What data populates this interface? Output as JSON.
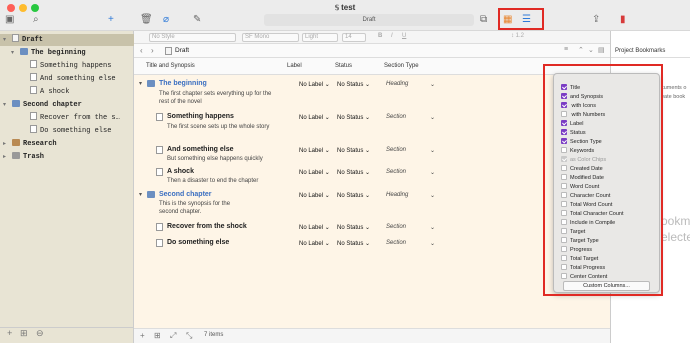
{
  "window": {
    "title": "test",
    "traffic": [
      "#fe5f57",
      "#febc2e",
      "#28c840"
    ]
  },
  "toolbar": {
    "draft_label": "Draft",
    "add": "+",
    "search": "⌕"
  },
  "binder": {
    "items": [
      {
        "label": "Draft",
        "level": 0,
        "kind": "draft",
        "selected": true,
        "arrow": "▾"
      },
      {
        "label": "The beginning",
        "level": 1,
        "kind": "folder",
        "arrow": "▾"
      },
      {
        "label": "Something happens",
        "level": 2,
        "kind": "doc"
      },
      {
        "label": "And something else",
        "level": 2,
        "kind": "doc"
      },
      {
        "label": "A shock",
        "level": 2,
        "kind": "doc"
      },
      {
        "label": "Second chapter",
        "level": 1,
        "kind": "folder",
        "arrow": "▾"
      },
      {
        "label": "Recover from the s…",
        "level": 2,
        "kind": "doc"
      },
      {
        "label": "Do something else",
        "level": 2,
        "kind": "doc"
      },
      {
        "label": "Research",
        "level": 0,
        "kind": "folder",
        "arrow": "▸"
      },
      {
        "label": "Trash",
        "level": 0,
        "kind": "folder",
        "arrow": "▸"
      }
    ]
  },
  "format": {
    "style": "No Style",
    "font": "SF Mono",
    "weight": "Light",
    "size": "14",
    "spacing": "1.2"
  },
  "path": {
    "crumb": "Draft"
  },
  "columns": {
    "title": "Title and Synopsis",
    "label": "Label",
    "status": "Status",
    "section": "Section Type"
  },
  "rows": [
    {
      "title": "The beginning",
      "synopsis": "The first chapter sets everything up for the rest of the novel",
      "label": "No Label",
      "status": "No Status",
      "section": "Heading",
      "folder": true
    },
    {
      "title": "Something happens",
      "synopsis": "The first scene sets up the whole story",
      "label": "No Label",
      "status": "No Status",
      "section": "Section",
      "folder": false
    },
    {
      "title": "And something else",
      "synopsis": "But something else happens quickly",
      "label": "No Label",
      "status": "No Status",
      "section": "Section",
      "folder": false
    },
    {
      "title": "A shock",
      "synopsis": "Then a disaster to end the chapter",
      "label": "No Label",
      "status": "No Status",
      "section": "Section",
      "folder": false
    },
    {
      "title": "Second chapter",
      "synopsis": "This is the synopsis for the second chapter.",
      "label": "No Label",
      "status": "No Status",
      "section": "Heading",
      "folder": true
    },
    {
      "title": "Recover from the shock",
      "synopsis": "",
      "label": "No Label",
      "status": "No Status",
      "section": "Section",
      "folder": false
    },
    {
      "title": "Do something else",
      "synopsis": "",
      "label": "No Label",
      "status": "No Status",
      "section": "Section",
      "folder": false
    }
  ],
  "footer": {
    "count": "7 items"
  },
  "inspector": {
    "header": "Project Bookmarks",
    "text1": "cuments o",
    "text2": "eate book",
    "big1": "ookm",
    "big2": "electe"
  },
  "menu": {
    "items": [
      {
        "label": "Title",
        "checked": true
      },
      {
        "label": "and Synopsis",
        "checked": true
      },
      {
        "label": "with Icons",
        "checked": true
      },
      {
        "label": "with Numbers",
        "checked": false
      },
      {
        "label": "Label",
        "checked": true
      },
      {
        "label": "Status",
        "checked": true
      },
      {
        "label": "Section Type",
        "checked": true
      },
      {
        "label": "Keywords",
        "checked": false
      },
      {
        "label": "as Color Chips",
        "checked": true,
        "dim": true
      },
      {
        "label": "Created Date",
        "checked": false
      },
      {
        "label": "Modified Date",
        "checked": false
      },
      {
        "label": "Word Count",
        "checked": false
      },
      {
        "label": "Character Count",
        "checked": false
      },
      {
        "label": "Total Word Count",
        "checked": false
      },
      {
        "label": "Total Character Count",
        "checked": false
      },
      {
        "label": "Include in Compile",
        "checked": false
      },
      {
        "label": "Target",
        "checked": false
      },
      {
        "label": "Target Type",
        "checked": false
      },
      {
        "label": "Progress",
        "checked": false
      },
      {
        "label": "Total Target",
        "checked": false
      },
      {
        "label": "Total Progress",
        "checked": false
      },
      {
        "label": "Center Content",
        "checked": false
      }
    ],
    "custom": "Custom Columns..."
  }
}
